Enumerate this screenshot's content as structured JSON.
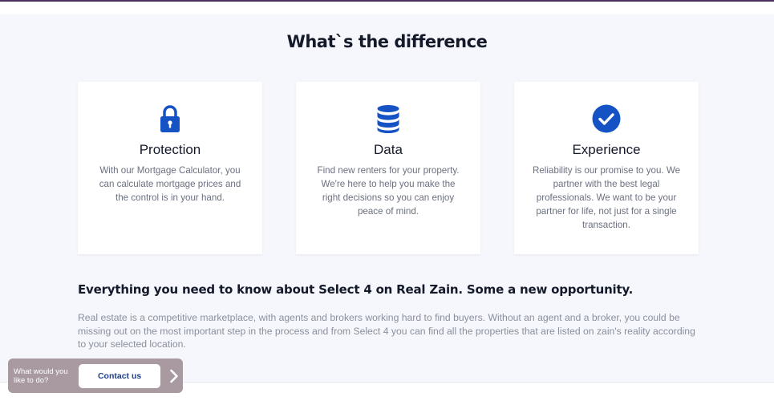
{
  "section": {
    "title": "What`s the difference"
  },
  "cards": [
    {
      "icon": "lock-icon",
      "title": "Protection",
      "text": "With our Mortgage Calculator, you can calculate mortgage prices and the control is in your hand."
    },
    {
      "icon": "database-icon",
      "title": "Data",
      "text": "Find new renters for your property. We're here to help you make the right decisions so you can enjoy peace of mind."
    },
    {
      "icon": "check-circle-icon",
      "title": "Experience",
      "text": "Reliability is our promise to you. We partner with the best legal professionals. We want to be your partner for life, not just for a single transaction."
    }
  ],
  "faq": {
    "heading": "Everything you need to know about Select 4 on Real Zain. Some a new opportunity.",
    "text": "Real estate is a competitive marketplace, with agents and brokers working hard to find buyers. Without an agent and a broker, you could be missing out on the most important step in the process and from Select 4 you can find all the properties that are listed on zain's reality according to your selected location."
  },
  "contact_widget": {
    "question": "What would you like to do?",
    "button_label": "Contact us",
    "arrow_icon": "chevron-right-icon"
  },
  "colors": {
    "accent": "#1553c4",
    "background": "#f5f7fc",
    "widget": "#a89aa0"
  }
}
